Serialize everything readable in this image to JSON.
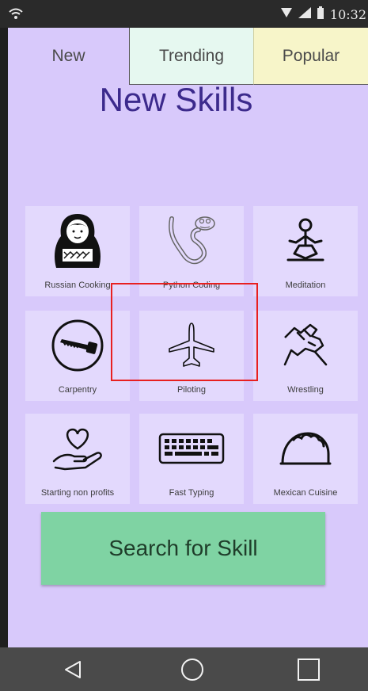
{
  "status_bar": {
    "time": "10:32",
    "icons": [
      "wifi-icon",
      "signal-icon",
      "battery-icon"
    ]
  },
  "tabs": [
    {
      "label": "New",
      "selected": true
    },
    {
      "label": "Trending",
      "selected": false
    },
    {
      "label": "Popular",
      "selected": false
    }
  ],
  "title": "New Skills",
  "skills": [
    {
      "label": "Russian Cooking",
      "icon": "matryoshka-icon"
    },
    {
      "label": "Python Coding",
      "icon": "snake-icon"
    },
    {
      "label": "Meditation",
      "icon": "meditation-icon"
    },
    {
      "label": "Carpentry",
      "icon": "saw-icon"
    },
    {
      "label": "Piloting",
      "icon": "airplane-icon"
    },
    {
      "label": "Wrestling",
      "icon": "handshake-icon"
    },
    {
      "label": "Starting non profits",
      "icon": "heart-hand-icon"
    },
    {
      "label": "Fast Typing",
      "icon": "keyboard-icon"
    },
    {
      "label": "Mexican Cuisine",
      "icon": "taco-icon"
    }
  ],
  "search_button": {
    "label": "Search for Skill"
  },
  "nav_bar": {
    "icons": [
      "back-icon",
      "home-icon",
      "recents-icon"
    ]
  }
}
